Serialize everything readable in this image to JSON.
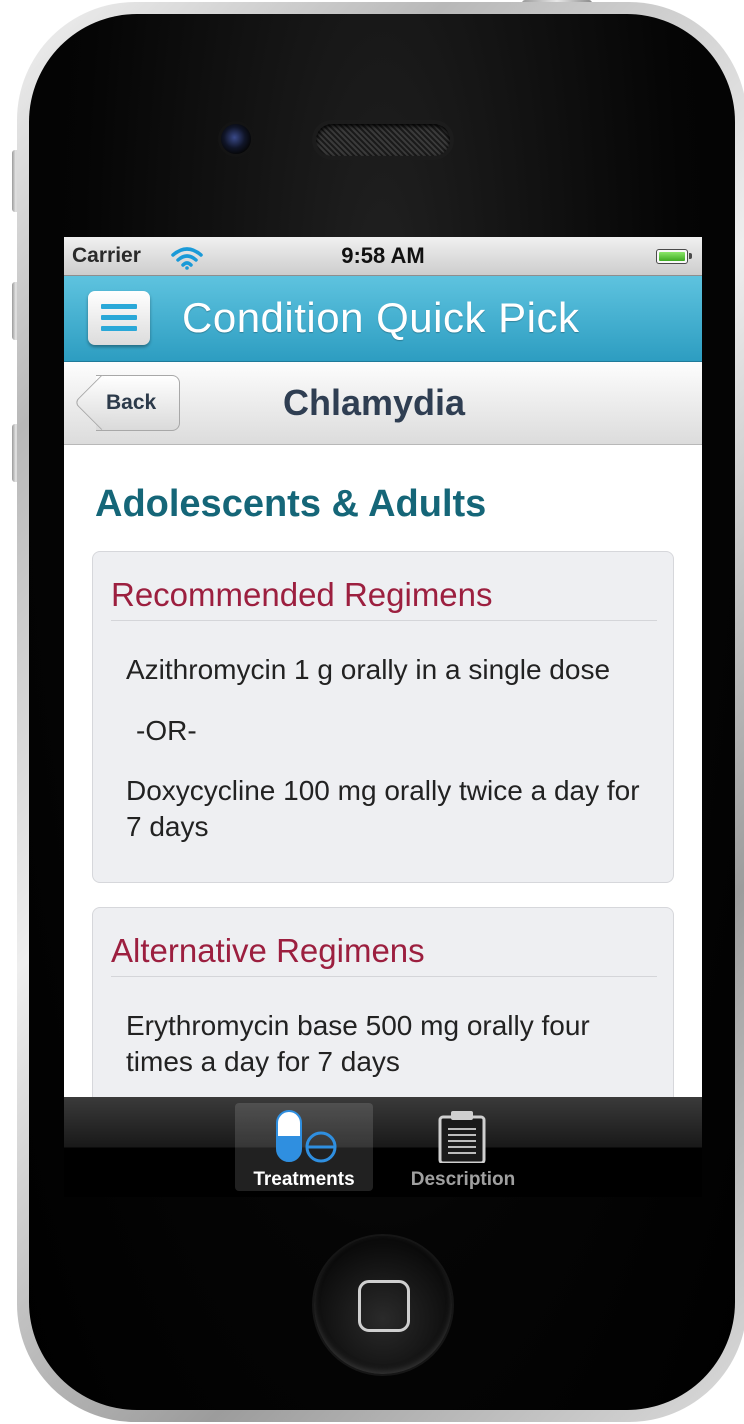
{
  "status_bar": {
    "carrier": "Carrier",
    "time": "9:58 AM"
  },
  "header": {
    "title": "Condition Quick Pick",
    "menu_icon": "hamburger-menu-icon"
  },
  "nav": {
    "back_label": "Back",
    "title": "Chlamydia"
  },
  "content": {
    "section_heading": "Adolescents & Adults",
    "recommended": {
      "title": "Recommended Regimens",
      "items": [
        "Azithromycin 1 g orally in a single dose",
        "-OR-",
        "Doxycycline 100 mg orally twice a day for 7 days"
      ]
    },
    "alternative": {
      "title": "Alternative Regimens",
      "items": [
        "Erythromycin base 500 mg orally four times a day for 7 days"
      ]
    }
  },
  "tabs": [
    {
      "label": "Treatments",
      "icon": "pill-icon",
      "selected": true
    },
    {
      "label": "Description",
      "icon": "clipboard-icon",
      "selected": false
    }
  ],
  "colors": {
    "header_blue": "#3aaed0",
    "heading_teal": "#156678",
    "card_title_red": "#9c1f3f",
    "card_bg": "#eeeff2"
  }
}
